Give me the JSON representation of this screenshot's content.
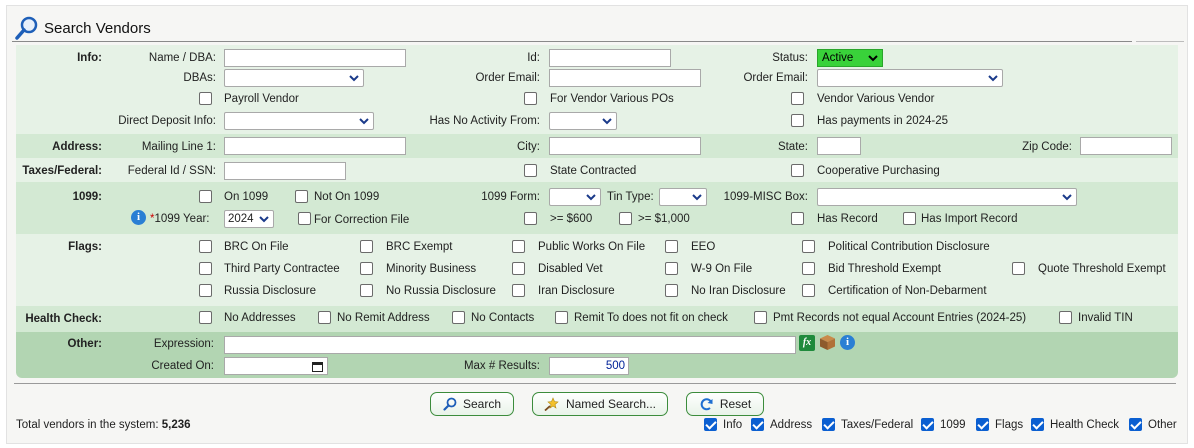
{
  "page": {
    "title": "Search Vendors"
  },
  "info": {
    "label": "Info:",
    "name_dba": "Name / DBA:",
    "id": "Id:",
    "status": "Status:",
    "status_value": "Active",
    "dbas": "DBAs:",
    "order_email": "Order Email:",
    "order_email2": "Order Email:",
    "payroll_vendor": "Payroll Vendor",
    "for_vendor_various": "For Vendor Various POs",
    "vendor_various_vendor": "Vendor Various Vendor",
    "direct_deposit": "Direct Deposit Info:",
    "no_activity": "Has No Activity From:",
    "has_payments": "Has payments in 2024-25"
  },
  "address": {
    "label": "Address:",
    "mailing": "Mailing Line 1:",
    "city": "City:",
    "state": "State:",
    "zip": "Zip Code:"
  },
  "taxes": {
    "label": "Taxes/Federal:",
    "fed_id": "Federal Id / SSN:",
    "state_contracted": "State Contracted",
    "coop": "Cooperative Purchasing"
  },
  "t1099": {
    "label": "1099:",
    "on_1099": "On 1099",
    "not_on_1099": "Not On 1099",
    "form": "1099 Form:",
    "tin_type": "Tin Type:",
    "misc_box": "1099-MISC Box:",
    "required_mark": "*",
    "year_label": "1099 Year:",
    "year_value": "2024",
    "correction": "For Correction File",
    "gte600": ">= $600",
    "gte1000": ">= $1,000",
    "has_record": "Has Record",
    "has_import": "Has Import Record"
  },
  "flags": {
    "label": "Flags:",
    "items": [
      "BRC On File",
      "BRC Exempt",
      "Public Works On File",
      "EEO",
      "Political Contribution Disclosure",
      "Third Party Contractee",
      "Minority Business",
      "Disabled Vet",
      "W-9 On File",
      "Bid Threshold Exempt",
      "Quote Threshold Exempt",
      "Russia Disclosure",
      "No Russia Disclosure",
      "Iran Disclosure",
      "No Iran Disclosure",
      "Certification of Non-Debarment"
    ]
  },
  "health": {
    "label": "Health Check:",
    "items": [
      "No Addresses",
      "No Remit Address",
      "No Contacts",
      "Remit To does not fit on check",
      "Pmt Records not equal Account Entries (2024-25)",
      "Invalid TIN"
    ]
  },
  "other": {
    "label": "Other:",
    "expression": "Expression:",
    "created_on": "Created On:",
    "max_results": "Max # Results:",
    "max_value": "500",
    "fx": "fx"
  },
  "buttons": {
    "search": "Search",
    "named_search": "Named Search...",
    "reset": "Reset"
  },
  "footer": {
    "total_label": "Total vendors in the system:",
    "total_value": "5,236",
    "toggles": [
      "Info",
      "Address",
      "Taxes/Federal",
      "1099",
      "Flags",
      "Health Check",
      "Other"
    ]
  },
  "colors": {
    "status_active": "#39d23a",
    "section_light": "#e6f2e6",
    "section_mid": "#d3e9d3",
    "section_dark": "#b2d5b2",
    "accent": "#0b5fd1"
  },
  "icons": [
    "search-magnifier-icon",
    "chevron-down-icon",
    "info-icon",
    "fx-icon",
    "box-icon",
    "calendar-icon",
    "refresh-icon",
    "wand-icon"
  ]
}
